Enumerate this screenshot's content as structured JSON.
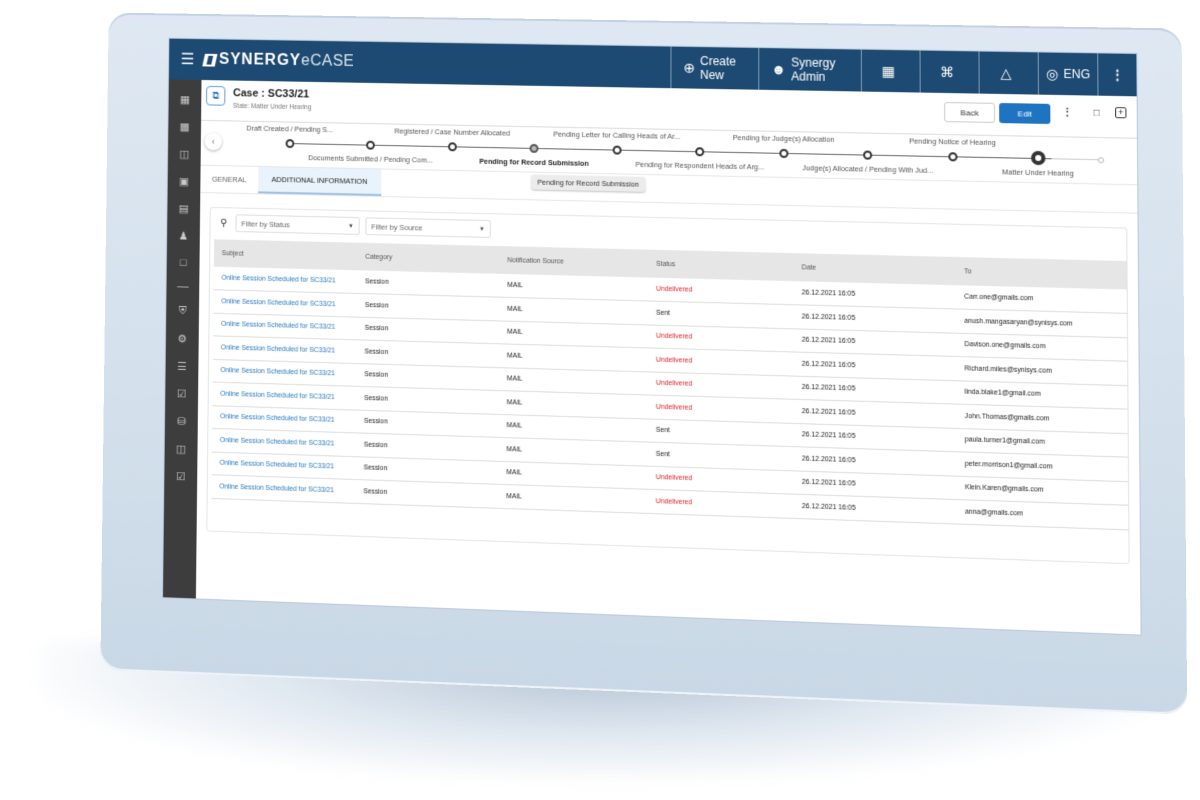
{
  "app": {
    "brand_bold": "SYNERGY",
    "brand_light": "eCASE"
  },
  "topbar": {
    "menu_icon": "hamburger-icon",
    "create_new": "Create New",
    "user": "Synergy Admin",
    "calendar_icon": "calendar-icon",
    "scan_icon": "scan-icon",
    "bell_icon": "bell-icon",
    "language": "ENG",
    "more_icon": "kebab-icon"
  },
  "sidebar": {
    "items": [
      "dashboard-icon",
      "chart-icon",
      "document-icon",
      "briefcase-icon",
      "ledger-icon",
      "users-icon",
      "book-icon",
      "shield-icon",
      "gear-icon",
      "hierarchy-icon",
      "checklist-icon",
      "database-icon",
      "monitor-icon",
      "task-icon"
    ]
  },
  "case": {
    "title": "Case : SC33/21",
    "state": "State: Matter Under Hearing",
    "back_label": "Back",
    "edit_label": "Edit"
  },
  "stepper": {
    "steps": [
      {
        "label": "Draft Created / Pending S...",
        "position": "top",
        "status": "done"
      },
      {
        "label": "Documents Submitted / Pending Com...",
        "position": "bottom",
        "status": "done"
      },
      {
        "label": "Registered / Case Number Allocated",
        "position": "top",
        "status": "done"
      },
      {
        "label": "Pending for Record Submission",
        "position": "bottom",
        "status": "hovered"
      },
      {
        "label": "Pending Letter for Calling Heads of Ar...",
        "position": "top",
        "status": "done"
      },
      {
        "label": "Pending for Respondent Heads of Arg...",
        "position": "bottom",
        "status": "done"
      },
      {
        "label": "Pending for Judge(s) Allocation",
        "position": "top",
        "status": "done"
      },
      {
        "label": "Judge(s) Allocated / Pending With Jud...",
        "position": "bottom",
        "status": "done"
      },
      {
        "label": "Pending Notice of Hearing",
        "position": "top",
        "status": "done"
      },
      {
        "label": "Matter Under Hearing",
        "position": "bottom",
        "status": "current"
      },
      {
        "label": "",
        "position": "none",
        "status": "future"
      }
    ],
    "tooltip": "Pending for Record Submission"
  },
  "tabs": [
    {
      "label": "GENERAL",
      "active": false
    },
    {
      "label": "ADDITIONAL INFORMATION",
      "active": true
    }
  ],
  "filters": {
    "status_placeholder": "Filter by Status",
    "source_placeholder": "Filter by Source"
  },
  "table": {
    "columns": [
      "Subject",
      "Category",
      "Notification Source",
      "Status",
      "Date",
      "To"
    ],
    "rows": [
      {
        "subject": "Online Session Scheduled for SC33/21",
        "category": "Session",
        "source": "MAIL",
        "status": "Undelivered",
        "date": "26.12.2021 16:05",
        "to": "Carr.one@gmails.com"
      },
      {
        "subject": "Online Session Scheduled for SC33/21",
        "category": "Session",
        "source": "MAIL",
        "status": "Sent",
        "date": "26.12.2021 16:05",
        "to": "anush.mangasaryan@synisys.com"
      },
      {
        "subject": "Online Session Scheduled for SC33/21",
        "category": "Session",
        "source": "MAIL",
        "status": "Undelivered",
        "date": "26.12.2021 16:05",
        "to": "Davison.one@gmails.com"
      },
      {
        "subject": "Online Session Scheduled for SC33/21",
        "category": "Session",
        "source": "MAIL",
        "status": "Undelivered",
        "date": "26.12.2021 16:05",
        "to": "Richard.miles@synisys.com"
      },
      {
        "subject": "Online Session Scheduled for SC33/21",
        "category": "Session",
        "source": "MAIL",
        "status": "Undelivered",
        "date": "26.12.2021 16:05",
        "to": "linda.blake1@gmail.com"
      },
      {
        "subject": "Online Session Scheduled for SC33/21",
        "category": "Session",
        "source": "MAIL",
        "status": "Undelivered",
        "date": "26.12.2021 16:05",
        "to": "John.Thomas@gmails.com"
      },
      {
        "subject": "Online Session Scheduled for SC33/21",
        "category": "Session",
        "source": "MAIL",
        "status": "Sent",
        "date": "26.12.2021 16:05",
        "to": "paula.turner1@gmail.com"
      },
      {
        "subject": "Online Session Scheduled for SC33/21",
        "category": "Session",
        "source": "MAIL",
        "status": "Sent",
        "date": "26.12.2021 16:05",
        "to": "peter.morrison1@gmail.com"
      },
      {
        "subject": "Online Session Scheduled for SC33/21",
        "category": "Session",
        "source": "MAIL",
        "status": "Undelivered",
        "date": "26.12.2021 16:05",
        "to": "Klein.Karen@gmails.com"
      },
      {
        "subject": "Online Session Scheduled for SC33/21",
        "category": "Session",
        "source": "MAIL",
        "status": "Undelivered",
        "date": "26.12.2021 16:05",
        "to": "anna@gmails.com"
      }
    ]
  },
  "colors": {
    "topbar": "#1d4a72",
    "sidebar": "#3d3d3d",
    "primary_button": "#1f74c2",
    "link": "#2679bf",
    "undelivered": "#e0212b",
    "bezel": "#d3e0ec"
  }
}
